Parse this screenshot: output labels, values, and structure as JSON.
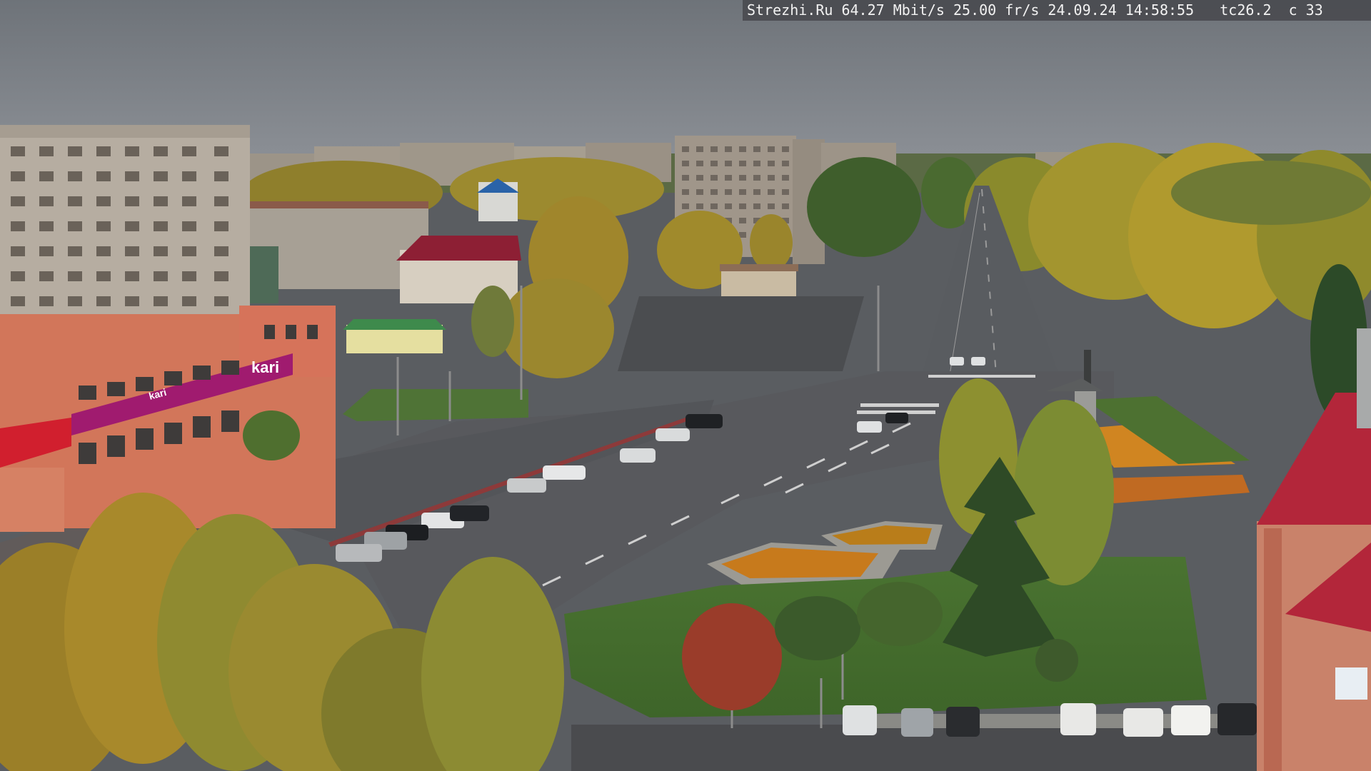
{
  "overlay": {
    "text": "Strezhi.Ru 64.27 Mbit/s 25.00 fr/s 24.09.24 14:58:55   tc26.2  c 33"
  },
  "signage": {
    "store_logo": "kari",
    "store_sign_small": "kari"
  },
  "colors": {
    "sky": "#7b8086",
    "road": "#55585c",
    "grass": "#4f7a33",
    "foliage_yellow": "#b39b2b",
    "brand_magenta": "#a01b6f",
    "roof_red": "#b3263a"
  }
}
